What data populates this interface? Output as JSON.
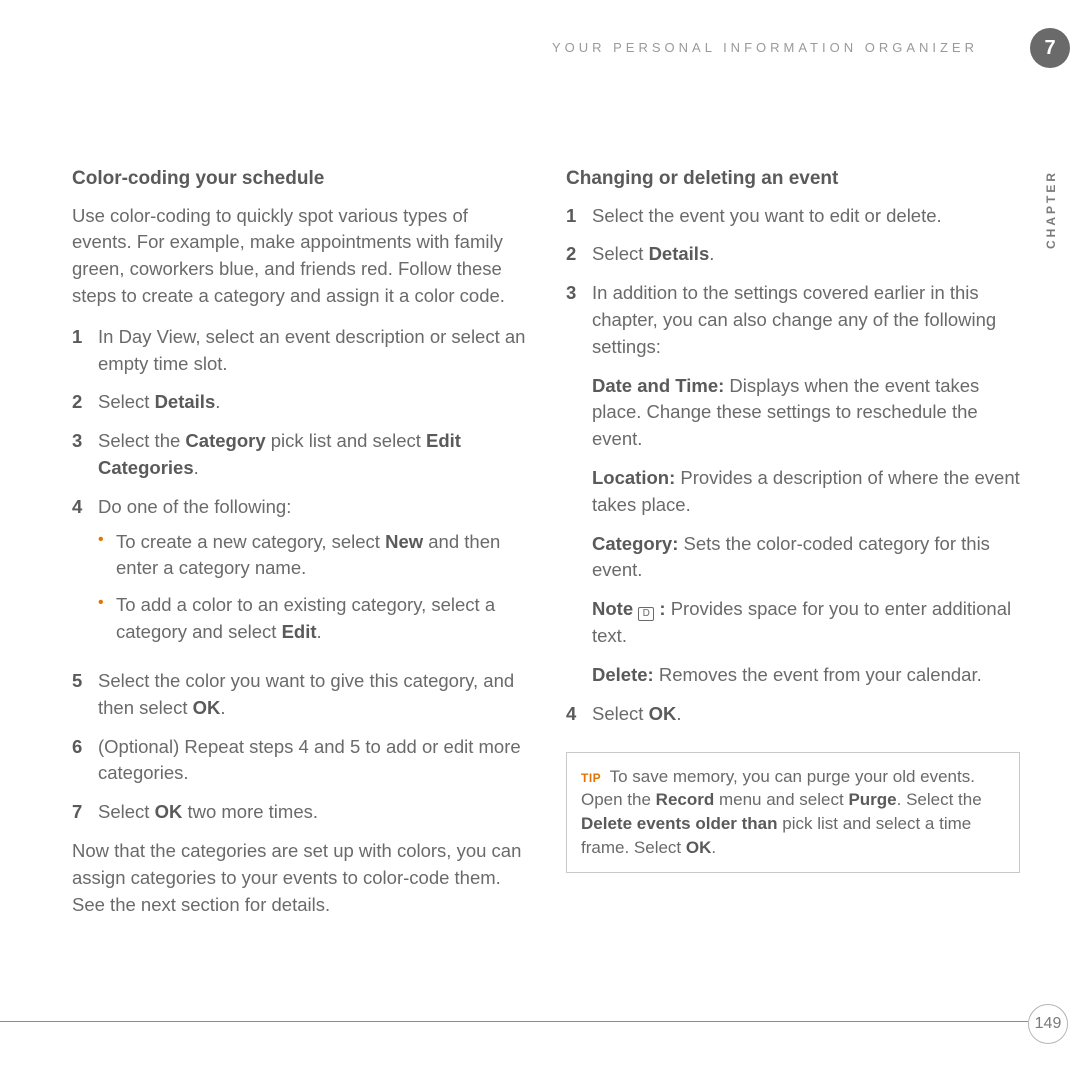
{
  "header": {
    "running": "YOUR PERSONAL INFORMATION ORGANIZER",
    "chapter_number": "7",
    "chapter_label": "CHAPTER"
  },
  "left": {
    "heading": "Color-coding your schedule",
    "intro": "Use color-coding to quickly spot various types of events. For example, make appointments with family green, coworkers blue, and friends red. Follow these steps to create a category and assign it a color code.",
    "steps": {
      "s1": {
        "num": "1",
        "text": "In Day View, select an event description or select an empty time slot."
      },
      "s2": {
        "num": "2",
        "pre": "Select ",
        "bold": "Details",
        "post": "."
      },
      "s3": {
        "num": "3",
        "pre": "Select the ",
        "bold1": "Category",
        "mid": " pick list and select ",
        "bold2": "Edit Categories",
        "post": "."
      },
      "s4": {
        "num": "4",
        "lead": "Do one of the following:",
        "b1": {
          "pre": "To create a new category, select ",
          "bold": "New",
          "post": " and then enter a category name."
        },
        "b2": {
          "pre": "To add a color to an existing category, select a category and select ",
          "bold": "Edit",
          "post": "."
        }
      },
      "s5": {
        "num": "5",
        "pre": "Select the color you want to give this category, and then select ",
        "bold": "OK",
        "post": "."
      },
      "s6": {
        "num": "6",
        "text": "(Optional)  Repeat steps 4 and 5 to add or edit more categories."
      },
      "s7": {
        "num": "7",
        "pre": "Select ",
        "bold": "OK",
        "post": " two more times."
      }
    },
    "outro": "Now that the categories are set up with colors, you can assign categories to your events to color-code them. See the next section for details."
  },
  "right": {
    "heading": "Changing or deleting an event",
    "steps": {
      "s1": {
        "num": "1",
        "text": "Select the event you want to edit or delete."
      },
      "s2": {
        "num": "2",
        "pre": "Select ",
        "bold": "Details",
        "post": "."
      },
      "s3": {
        "num": "3",
        "lead": "In addition to the settings covered earlier in this chapter, you can also change any of the following settings:",
        "items": {
          "dt": {
            "label": "Date and Time:",
            "text": " Displays when the event takes place. Change these settings to reschedule the event."
          },
          "loc": {
            "label": "Location:",
            "text": " Provides a description of where the event takes place."
          },
          "cat": {
            "label": "Category:",
            "text": " Sets the color-coded category for this event."
          },
          "note": {
            "label_pre": "Note ",
            "icon_glyph": "D",
            "label_post": " :",
            "text": " Provides space for you to enter additional text."
          },
          "del": {
            "label": "Delete:",
            "text": " Removes the event from your calendar."
          }
        }
      },
      "s4": {
        "num": "4",
        "pre": "Select ",
        "bold": "OK",
        "post": "."
      }
    },
    "tip": {
      "label": "TIP",
      "pre": " To save memory, you can purge your old events. Open the ",
      "b1": "Record",
      "mid1": " menu and select ",
      "b2": "Purge",
      "mid2": ". Select the ",
      "b3": "Delete events older than",
      "mid3": " pick list and select a time frame. Select ",
      "b4": "OK",
      "post": "."
    }
  },
  "footer": {
    "page": "149"
  }
}
